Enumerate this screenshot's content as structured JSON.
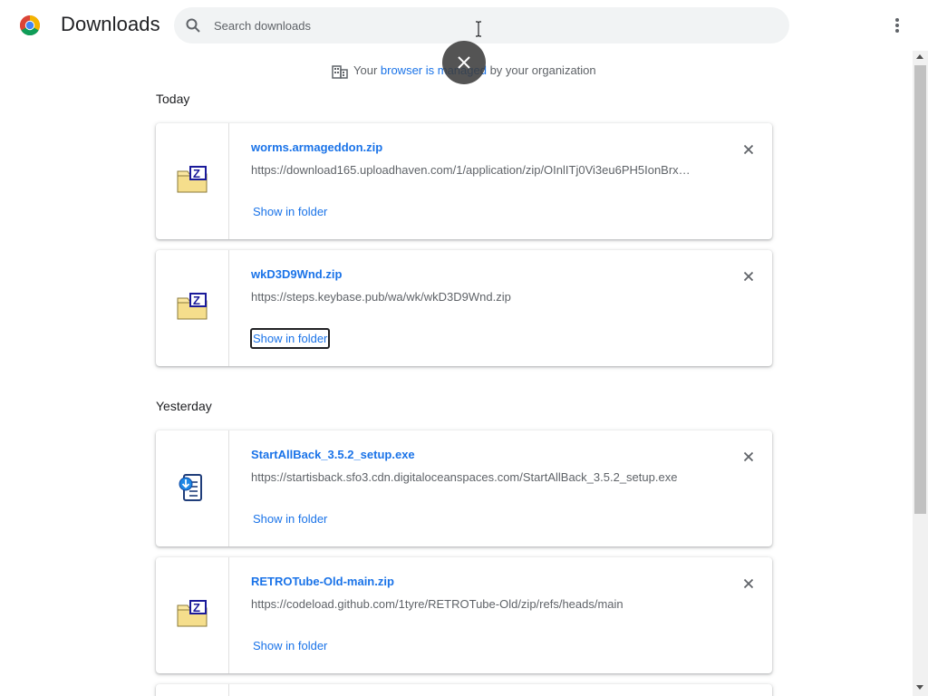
{
  "header": {
    "title": "Downloads",
    "search_placeholder": "Search downloads"
  },
  "managed_notice": {
    "prefix": "Your ",
    "link": "browser is managed",
    "suffix": " by your organization"
  },
  "sections": [
    {
      "label": "Today",
      "items": [
        {
          "filename": "worms.armageddon.zip",
          "url": "https://download165.uploadhaven.com/1/application/zip/OInlITj0Vi3eu6PH5IonBrx…",
          "action": "Show in folder",
          "icon": "zip-file-icon"
        },
        {
          "filename": "wkD3D9Wnd.zip",
          "url": "https://steps.keybase.pub/wa/wk/wkD3D9Wnd.zip",
          "action": "Show in folder",
          "icon": "zip-file-icon"
        }
      ]
    },
    {
      "label": "Yesterday",
      "items": [
        {
          "filename": "StartAllBack_3.5.2_setup.exe",
          "url": "https://startisback.sfo3.cdn.digitaloceanspaces.com/StartAllBack_3.5.2_setup.exe",
          "action": "Show in folder",
          "icon": "installer-icon"
        },
        {
          "filename": "RETROTube-Old-main.zip",
          "url": "https://codeload.github.com/1tyre/RETROTube-Old/zip/refs/heads/main",
          "action": "Show in folder",
          "icon": "zip-file-icon"
        }
      ]
    }
  ],
  "colors": {
    "accent": "#1a73e8",
    "secondary_text": "#5f6368",
    "primary_text": "#202124"
  }
}
